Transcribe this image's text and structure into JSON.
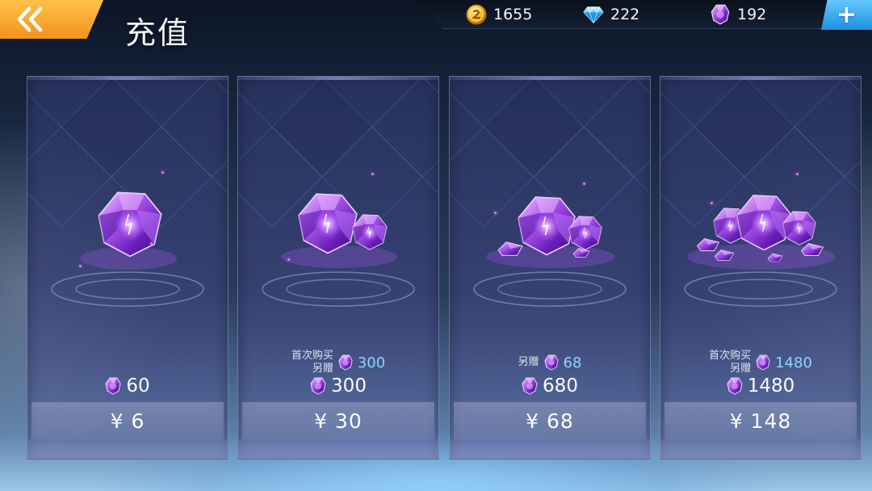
{
  "header": {
    "title": "充值",
    "back_icon": "double-chevron-left-icon"
  },
  "resources": {
    "coin": {
      "icon": "gold-coin-icon",
      "value": "1655"
    },
    "diamond": {
      "icon": "blue-diamond-icon",
      "value": "222"
    },
    "crystal": {
      "icon": "purple-crystal-icon",
      "value": "192"
    },
    "add_label": "+"
  },
  "colors": {
    "accent_orange": "#f7a22a",
    "accent_blue": "#2fa6f0",
    "crystal_purple": "#9b4de0",
    "bonus_text": "#8fd3ff"
  },
  "packages": [
    {
      "amount": "60",
      "price": "¥ 6",
      "bonus_label_1": "",
      "bonus_label_2": "",
      "bonus_value": "",
      "gems": 1
    },
    {
      "amount": "300",
      "price": "¥ 30",
      "bonus_label_1": "首次购买",
      "bonus_label_2": "另赠",
      "bonus_value": "300",
      "gems": 2
    },
    {
      "amount": "680",
      "price": "¥ 68",
      "bonus_label_1": "另赠",
      "bonus_label_2": "",
      "bonus_value": "68",
      "gems": 3
    },
    {
      "amount": "1480",
      "price": "¥ 148",
      "bonus_label_1": "首次购买",
      "bonus_label_2": "另赠",
      "bonus_value": "1480",
      "gems": 4
    }
  ]
}
